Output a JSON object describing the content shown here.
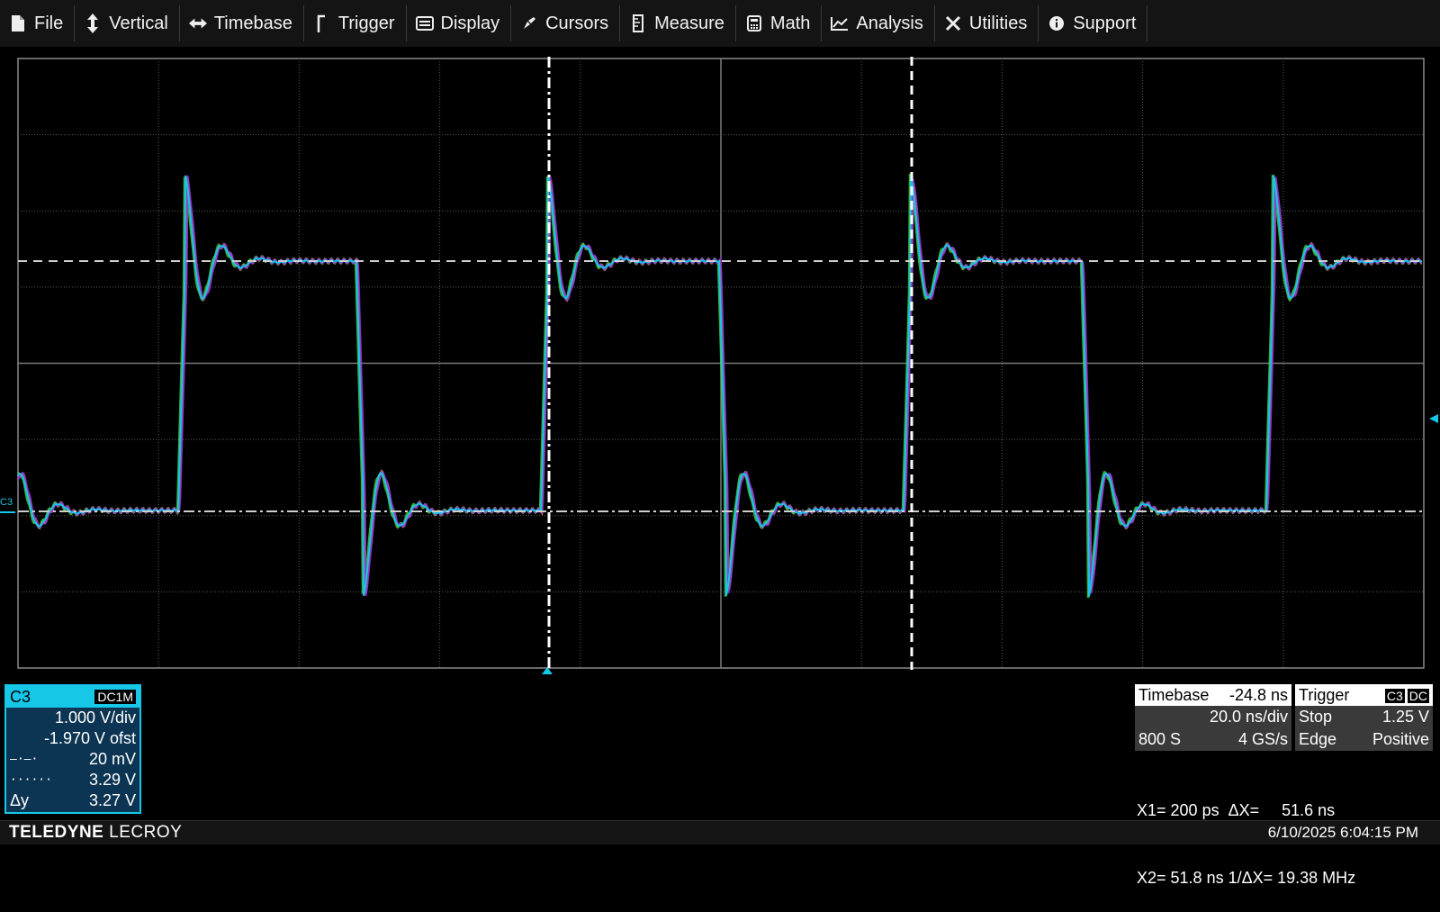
{
  "menu": [
    {
      "label": "File",
      "icon": "file-icon"
    },
    {
      "label": "Vertical",
      "icon": "vertical-arrows-icon"
    },
    {
      "label": "Timebase",
      "icon": "horizontal-arrows-icon"
    },
    {
      "label": "Trigger",
      "icon": "trigger-icon"
    },
    {
      "label": "Display",
      "icon": "display-icon"
    },
    {
      "label": "Cursors",
      "icon": "cursor-icon"
    },
    {
      "label": "Measure",
      "icon": "measure-icon"
    },
    {
      "label": "Math",
      "icon": "calculator-icon"
    },
    {
      "label": "Analysis",
      "icon": "chart-icon"
    },
    {
      "label": "Utilities",
      "icon": "tools-icon"
    },
    {
      "label": "Support",
      "icon": "info-icon"
    }
  ],
  "channel_marker": "C3",
  "channel": {
    "name": "C3",
    "coupling": "DC1M",
    "vdiv": "1.000 V/div",
    "offset": "-1.970 V ofst",
    "cursor1_sym": "–·–·",
    "cursor1_val": "20 mV",
    "cursor2_sym": "······",
    "cursor2_val": "3.29 V",
    "delta_label": "Δy",
    "delta_val": "3.27 V",
    "color": "#17c7e8"
  },
  "timebase": {
    "label": "Timebase",
    "delay": "-24.8 ns",
    "tdiv": "20.0 ns/div",
    "samples": "800 S",
    "rate": "4 GS/s"
  },
  "trigger": {
    "label": "Trigger",
    "source": "C3",
    "coupling": "DC",
    "mode": "Stop",
    "level": "1.25 V",
    "type": "Edge",
    "slope": "Positive"
  },
  "cursor_readout": {
    "line1": "X1= 200 ps  ΔX=     51.6 ns",
    "line2": "X2= 51.8 ns 1/ΔX= 19.38 MHz"
  },
  "status": {
    "brand_bold": "TELEDYNE",
    "brand_rest": " LECROY",
    "datetime": "6/10/2025 6:04:15 PM"
  },
  "colors": {
    "trace_primary": "#17c7e8",
    "trace_persist": "#8a2be2",
    "grid": "#5a5a5a",
    "cursor": "#ffffff"
  }
}
